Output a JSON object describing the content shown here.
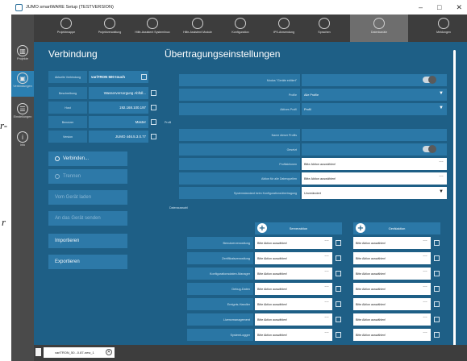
{
  "window": {
    "title": "JUMO smartWARE Setup (TESTVERSION)",
    "controls": [
      "–",
      "□",
      "✕"
    ]
  },
  "toolbar": {
    "items": [
      {
        "label": "Projektmappe"
      },
      {
        "label": "Projektverwaltung"
      },
      {
        "label": "Hilfe-Assistent Systemlinux"
      },
      {
        "label": "Hilfe-Assistent Module"
      },
      {
        "label": "Konfiguration"
      },
      {
        "label": "IPS-Anwendung"
      },
      {
        "label": "Sprachen"
      },
      {
        "label": "Datenkanäle"
      },
      {
        "label": "Meldungen"
      }
    ]
  },
  "left_rail": {
    "items": [
      {
        "label": "Projekte",
        "icon": "folder-icon"
      },
      {
        "label": "Verbindungen",
        "icon": "connection-icon"
      },
      {
        "label": "Einstellungen",
        "icon": "list-icon"
      },
      {
        "label": "Info",
        "icon": "info-icon"
      }
    ]
  },
  "left_panel": {
    "title": "Verbindung",
    "info": [
      {
        "label": "Aktuelle Verbindung",
        "value": "variTRON 500 touch"
      },
      {
        "label": "Beschreibung",
        "value": "Wasserversorgung Abfüll..."
      },
      {
        "label": "Host",
        "value": "192.168.100.197"
      },
      {
        "label": "Benutzer",
        "value": "Master"
      },
      {
        "label": "Version",
        "value": "JUMO 446.5.3.0.77"
      }
    ],
    "buttons": [
      {
        "label": "Verbinden..."
      },
      {
        "label": "Trennen"
      },
      {
        "label": "Vom Gerät laden"
      },
      {
        "label": "An das Gerät senden"
      },
      {
        "label": "Importieren"
      },
      {
        "label": "Exportieren"
      }
    ]
  },
  "main": {
    "title": "Übertragungseinstellungen",
    "fields": {
      "reduce_label": "Modus \"Geräte editiert\"",
      "profile_label": "Profile",
      "profile_value": "Alle Profile",
      "active_profile_label": "Aktives Profil",
      "active_profile_value": "Profil"
    },
    "profil_section": "Profil",
    "profil_fields": {
      "name_label": "Name dieser Profils",
      "send_label": "Gesetzt",
      "prio_label": "Profilaktionen",
      "prio_value": "Bitte Aktion auswählen!",
      "data_label": "Aktion für alle Datenquellen",
      "data_value": "Bitte Aktion auswählen!",
      "conf_label": "Systemstandard beim Konfigurationsübertragung",
      "conf_value": "Unverändert"
    },
    "datasets_section": "Datenauswahl",
    "columns": [
      "Serveraktion",
      "Gerätaktion"
    ],
    "rows": [
      {
        "label": "Benutzerverwaltung",
        "a": "Bitte Aktion auswählen!",
        "b": "Bitte Aktion auswählen!"
      },
      {
        "label": "Zertifikatsverwaltung",
        "a": "Bitte Aktion auswählen!",
        "b": "Bitte Aktion auswählen!"
      },
      {
        "label": "Konfigurationsdaten-Manager",
        "a": "Bitte Aktion auswählen!",
        "b": "Bitte Aktion auswählen!"
      },
      {
        "label": "Debug-Daten",
        "a": "Bitte Aktion auswählen!",
        "b": "Bitte Aktion auswählen!"
      },
      {
        "label": "Ereignis-Handler",
        "a": "Bitte Aktion auswählen!",
        "b": "Bitte Aktion auswählen!"
      },
      {
        "label": "Lizenzmanagement",
        "a": "Bitte Aktion auswählen!",
        "b": "Bitte Aktion auswählen!"
      },
      {
        "label": "SystemLogger",
        "a": "Bitte Aktion auswählen!",
        "b": "Bitte Aktion auswählen!"
      }
    ]
  },
  "taskbar": {
    "tab_label": "variTRON_50...0.87-new_1"
  },
  "outside_text": [
    "r-",
    "r"
  ]
}
